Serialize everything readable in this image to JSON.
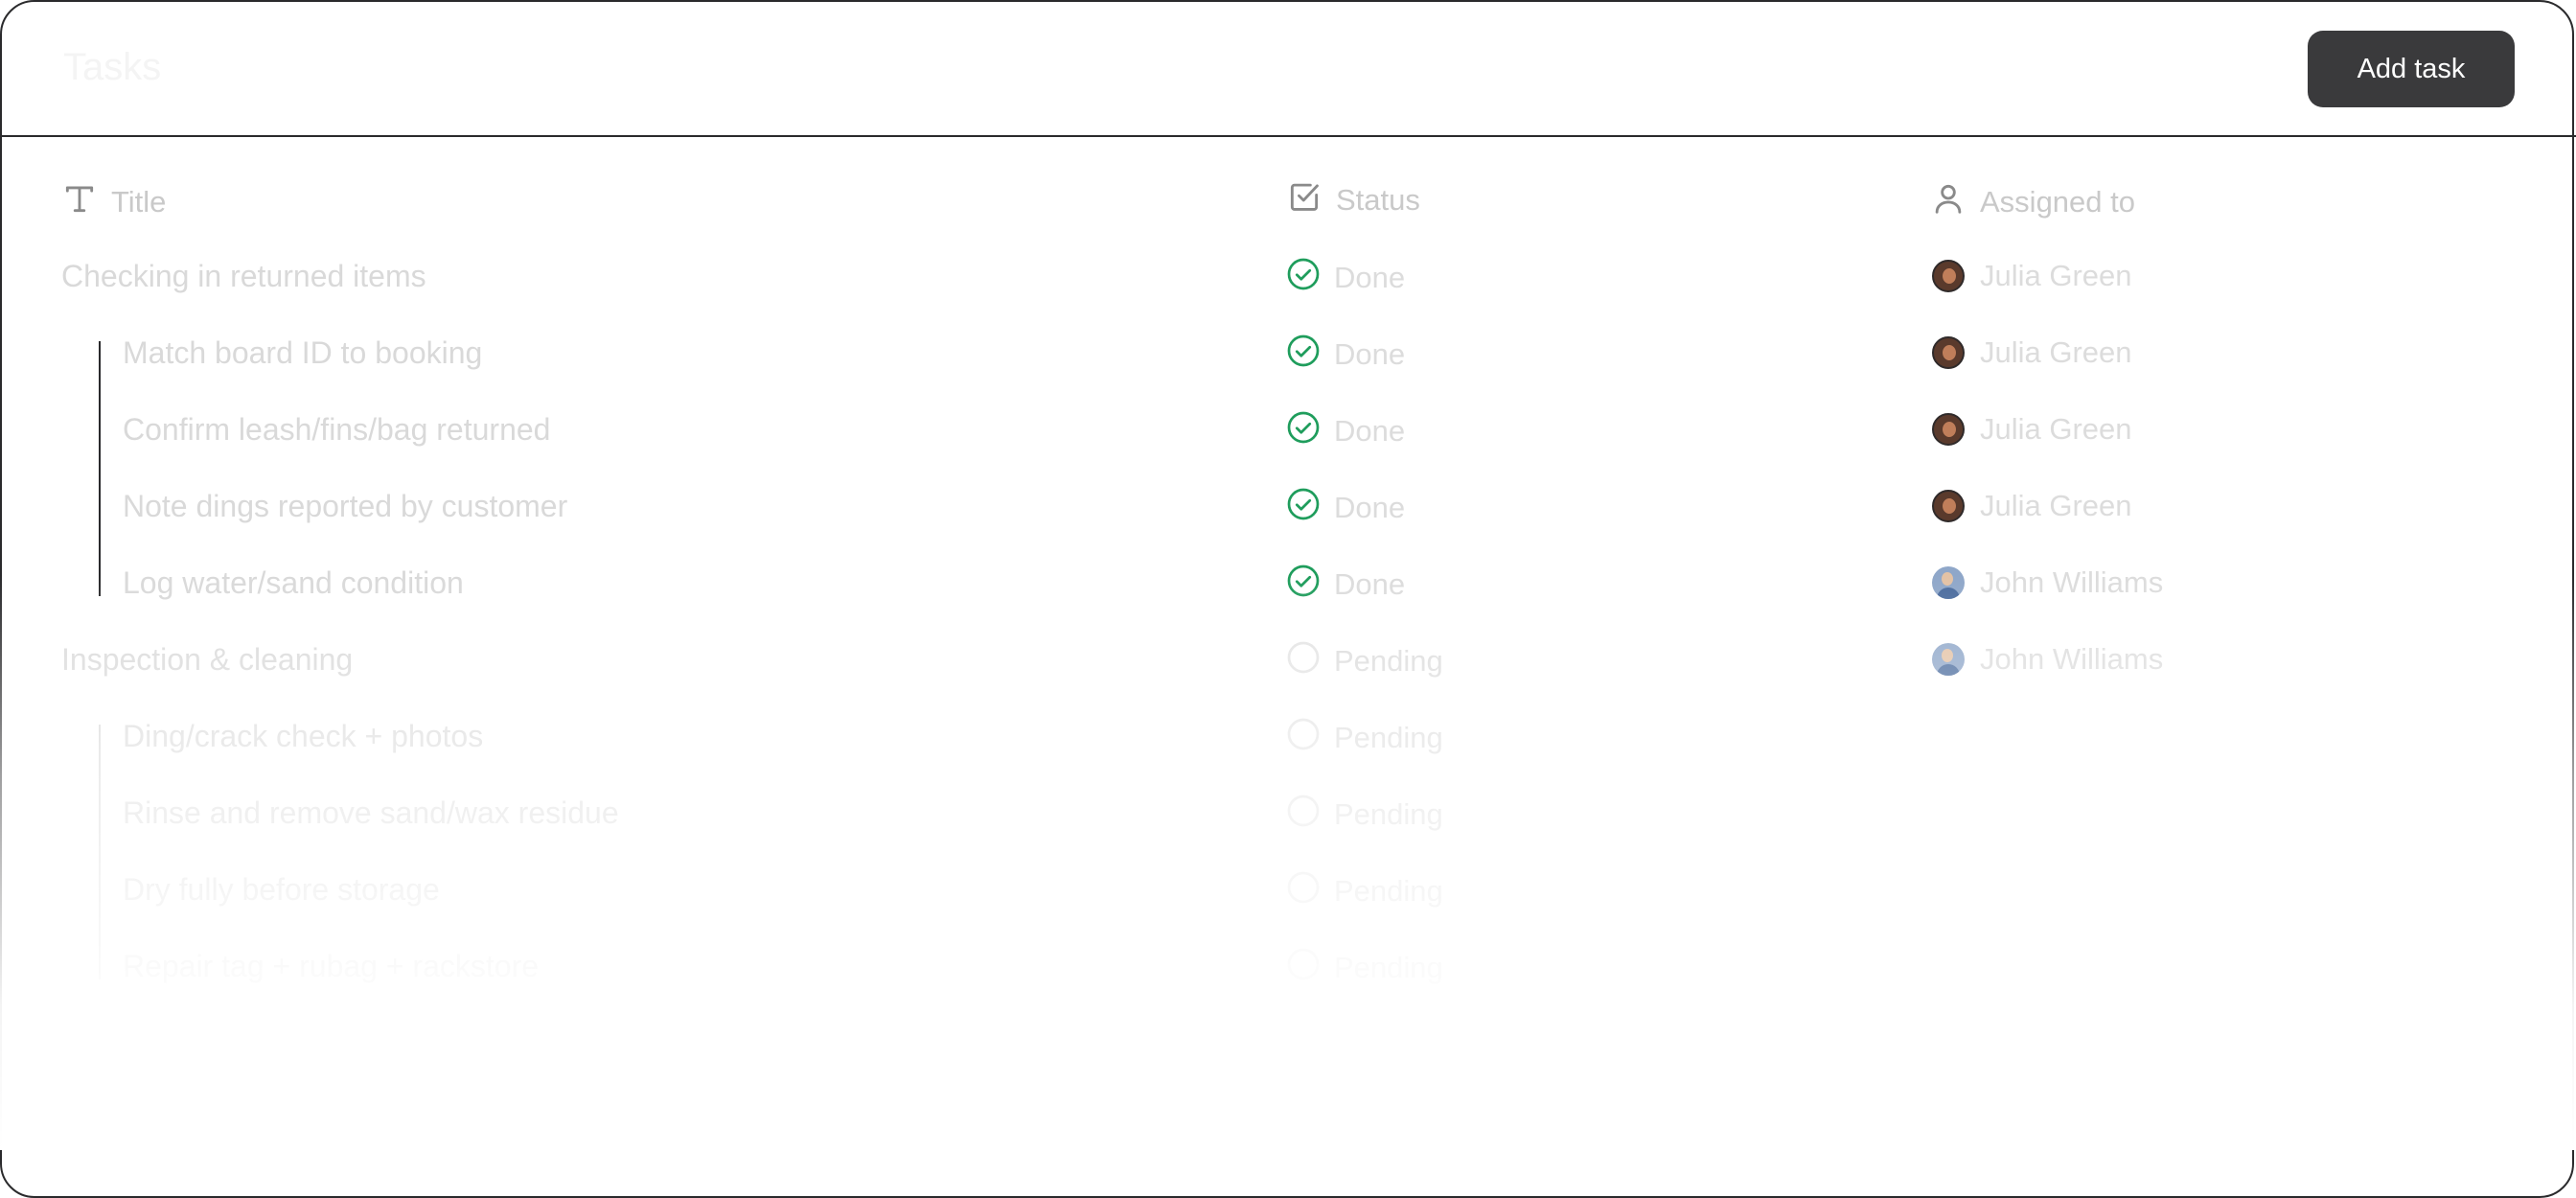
{
  "header": {
    "brand": "Tasks",
    "add_task_label": "Add task"
  },
  "columns": {
    "title": "Title",
    "status": "Status",
    "assigned_to": "Assigned to"
  },
  "icons": {
    "title_col": "text-type-icon",
    "status_col": "checkbox-icon",
    "assigned_col": "person-icon",
    "done": "check-circle-icon",
    "pending": "empty-circle-icon"
  },
  "colors": {
    "done_green": "#1f9d5c",
    "button_bg": "#3a3a3c"
  },
  "rows": [
    {
      "title": "Checking in returned items",
      "status": "Done",
      "assignee": "Julia Green"
    },
    {
      "title": "Match board ID to booking",
      "status": "Done",
      "assignee": "Julia Green"
    },
    {
      "title": "Confirm leash/fins/bag returned",
      "status": "Done",
      "assignee": "Julia Green"
    },
    {
      "title": "Note dings reported by customer",
      "status": "Done",
      "assignee": "Julia Green"
    },
    {
      "title": "Log water/sand condition",
      "status": "Done",
      "assignee": "John Williams"
    },
    {
      "title": "Inspection & cleaning",
      "status": "Pending",
      "assignee": "John Williams"
    },
    {
      "title": "Ding/crack check + photos",
      "status": "Pending",
      "assignee": ""
    },
    {
      "title": "Rinse and remove sand/wax residue",
      "status": "Pending",
      "assignee": ""
    },
    {
      "title": "Dry fully before storage",
      "status": "Pending",
      "assignee": ""
    },
    {
      "title": "Repair tag + rubag + rackstore",
      "status": "Pending",
      "assignee": ""
    }
  ]
}
